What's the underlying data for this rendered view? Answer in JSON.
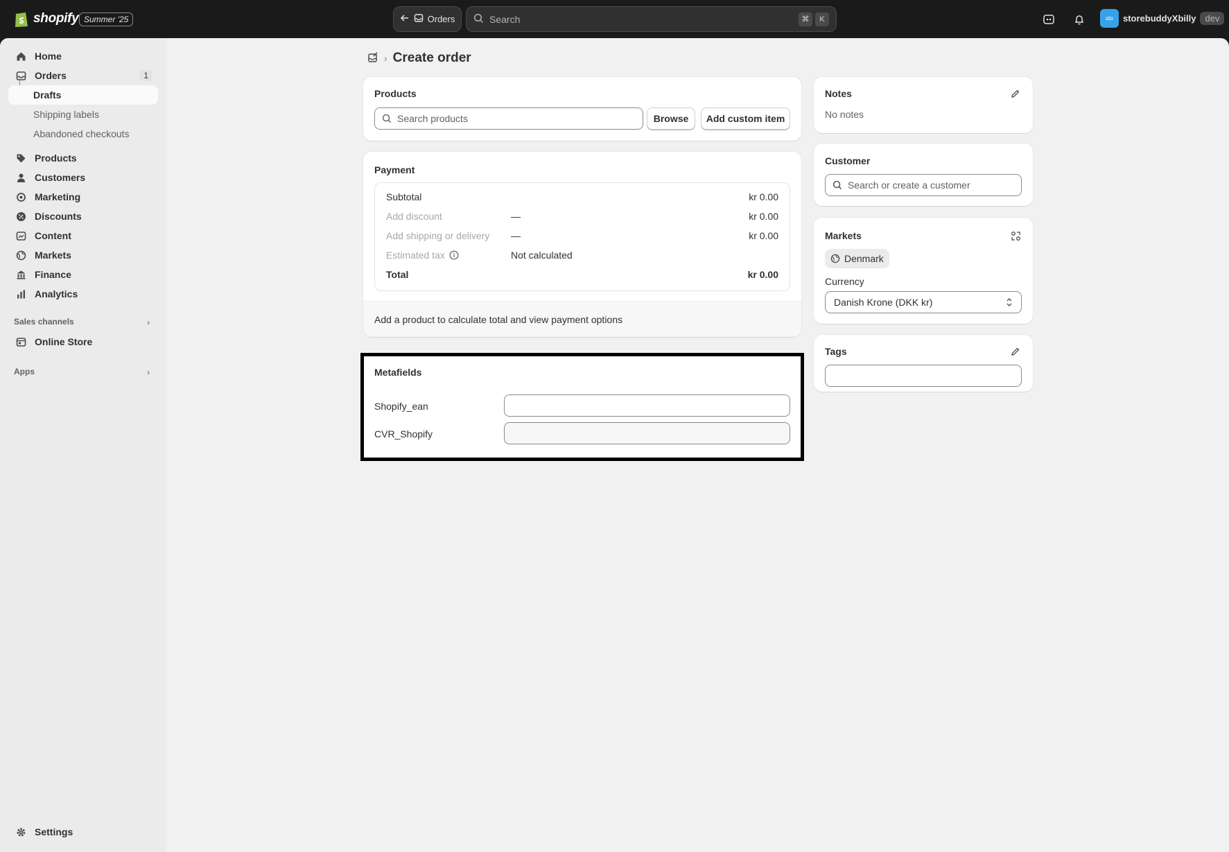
{
  "topbar": {
    "brand": "shopify",
    "edition": "Summer '25",
    "nav_back_label": "Orders",
    "search_placeholder": "Search",
    "shortcut_keys": [
      "⌘",
      "K"
    ],
    "store_avatar": "sto",
    "store_name": "storebuddyXbilly",
    "store_badge": "dev"
  },
  "sidebar": {
    "items": [
      {
        "label": "Home",
        "icon": "home-icon"
      },
      {
        "label": "Orders",
        "icon": "orders-icon",
        "badge": "1"
      },
      {
        "label": "Drafts"
      },
      {
        "label": "Shipping labels"
      },
      {
        "label": "Abandoned checkouts"
      },
      {
        "label": "Products",
        "icon": "tag-icon"
      },
      {
        "label": "Customers",
        "icon": "person-icon"
      },
      {
        "label": "Marketing",
        "icon": "target-icon"
      },
      {
        "label": "Discounts",
        "icon": "discount-icon"
      },
      {
        "label": "Content",
        "icon": "content-icon"
      },
      {
        "label": "Markets",
        "icon": "globe-icon"
      },
      {
        "label": "Finance",
        "icon": "bank-icon"
      },
      {
        "label": "Analytics",
        "icon": "chart-icon"
      }
    ],
    "sales_channels_label": "Sales channels",
    "online_store_label": "Online Store",
    "apps_label": "Apps",
    "settings_label": "Settings"
  },
  "page": {
    "title": "Create order"
  },
  "products_card": {
    "title": "Products",
    "search_placeholder": "Search products",
    "browse_label": "Browse",
    "add_custom_label": "Add custom item"
  },
  "payment_card": {
    "title": "Payment",
    "rows": [
      {
        "label": "Subtotal",
        "middle": "",
        "amount": "kr 0.00"
      },
      {
        "label": "Add discount",
        "middle": "—",
        "amount": "kr 0.00"
      },
      {
        "label": "Add shipping or delivery",
        "middle": "—",
        "amount": "kr 0.00"
      },
      {
        "label": "Estimated tax",
        "middle": "Not calculated",
        "amount": ""
      },
      {
        "label": "Total",
        "middle": "",
        "amount": "kr 0.00"
      }
    ],
    "footer_text": "Add a product to calculate total and view payment options"
  },
  "metafields_card": {
    "title": "Metafields",
    "fields": [
      {
        "label": "Shopify_ean",
        "value": ""
      },
      {
        "label": "CVR_Shopify",
        "value": ""
      }
    ]
  },
  "notes_card": {
    "title": "Notes",
    "text": "No notes"
  },
  "customer_card": {
    "title": "Customer",
    "search_placeholder": "Search or create a customer"
  },
  "markets_card": {
    "title": "Markets",
    "market": "Denmark",
    "currency_label": "Currency",
    "currency_value": "Danish Krone (DKK kr)"
  },
  "tags_card": {
    "title": "Tags",
    "value": ""
  },
  "colors": {
    "topbar": "#1a1a1a",
    "page_bg": "#f1f1f1",
    "sidebar_bg": "#ebebeb",
    "avatar": "#36a3e8"
  }
}
